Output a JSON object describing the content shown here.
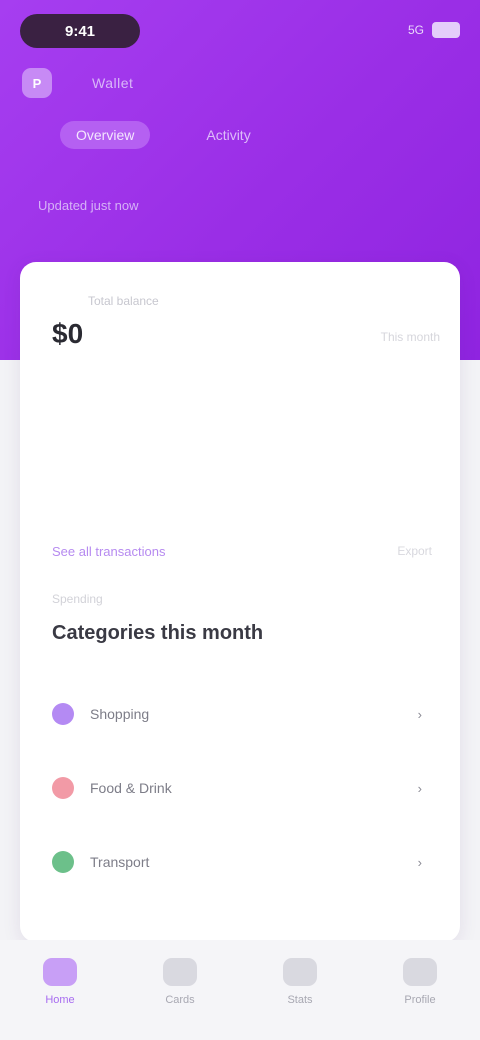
{
  "status_bar": {
    "time": "9:41",
    "signal": "5G"
  },
  "header": {
    "avatar_initial": "P",
    "title": "Wallet",
    "tabs": [
      {
        "label": "Overview",
        "active": true
      },
      {
        "label": "Activity",
        "active": false
      }
    ],
    "subtitle": "Updated just now"
  },
  "card": {
    "balance_label": "Total balance",
    "balance_value": "$0",
    "note": "This month",
    "link_primary": "See all transactions",
    "link_secondary": "Export"
  },
  "section": {
    "label": "Spending",
    "title": "Categories this month"
  },
  "list": [
    {
      "label": "Shopping",
      "value": "›",
      "color": "#b48af3"
    },
    {
      "label": "Food & Drink",
      "value": "›",
      "color": "#f29aa6"
    },
    {
      "label": "Transport",
      "value": "›",
      "color": "#6cc08a"
    }
  ],
  "nav": [
    {
      "label": "Home",
      "active": true,
      "icon": "home-icon"
    },
    {
      "label": "Cards",
      "active": false,
      "icon": "card-icon"
    },
    {
      "label": "Stats",
      "active": false,
      "icon": "chart-icon"
    },
    {
      "label": "Profile",
      "active": false,
      "icon": "user-icon"
    }
  ],
  "colors": {
    "accent": "#9a2ee6",
    "accent_light": "#c89ff6"
  }
}
